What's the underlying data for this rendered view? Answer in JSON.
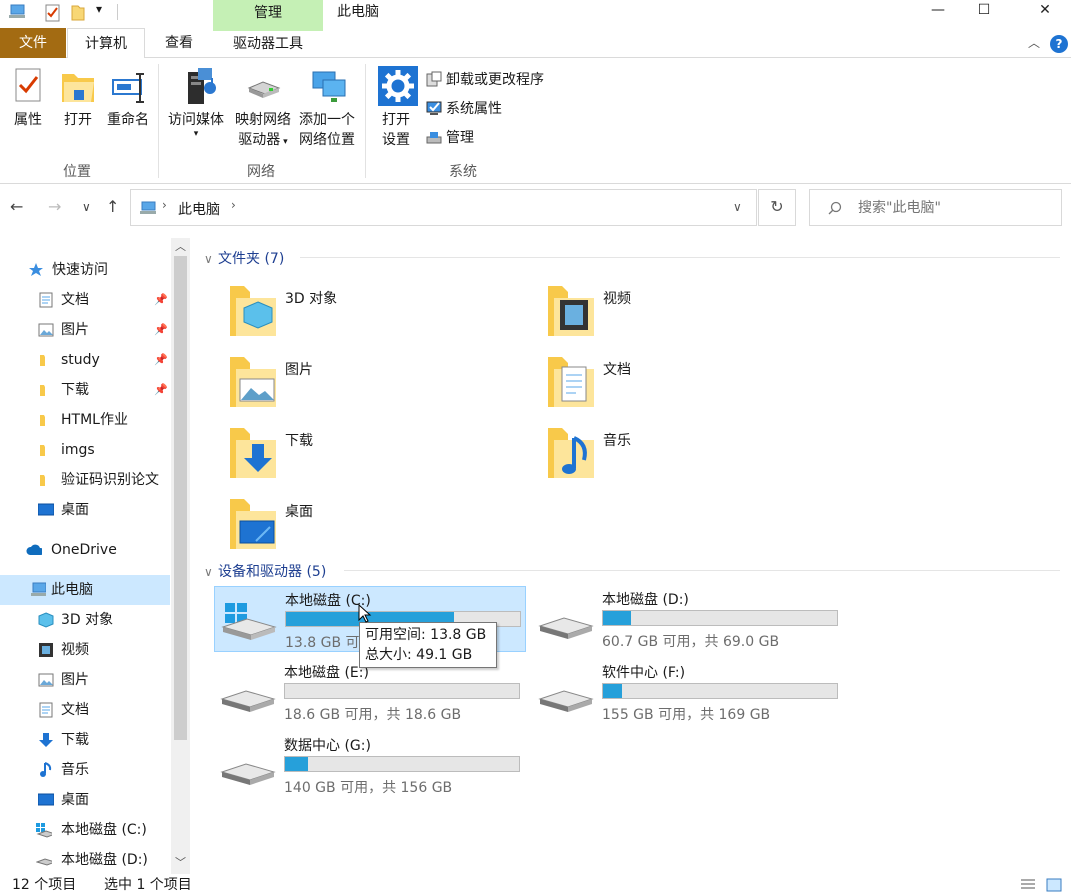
{
  "titlebar": {
    "title": "此电脑",
    "context_group": "管理",
    "qa_dropdown": "▾",
    "minimize": "—",
    "maximize": "☐",
    "close": "✕"
  },
  "tabs": {
    "file": "文件",
    "computer": "计算机",
    "view": "查看",
    "drive_tools": "驱动器工具"
  },
  "ribbon": {
    "properties": "属性",
    "open": "打开",
    "rename": "重命名",
    "access_media": "访问媒体",
    "map_drive_line1": "映射网络",
    "map_drive_line2": "驱动器",
    "add_location_line1": "添加一个",
    "add_location_line2": "网络位置",
    "open_settings_line1": "打开",
    "open_settings_line2": "设置",
    "uninstall": "卸载或更改程序",
    "system_props": "系统属性",
    "manage": "管理",
    "group_location": "位置",
    "group_network": "网络",
    "group_system": "系统",
    "help": "?"
  },
  "address": {
    "path": "此电脑",
    "search_placeholder": "搜索\"此电脑\""
  },
  "navpane": {
    "quick_access": "快速访问",
    "items": [
      {
        "label": "文档"
      },
      {
        "label": "图片"
      },
      {
        "label": "study"
      },
      {
        "label": "下载"
      },
      {
        "label": "HTML作业"
      },
      {
        "label": "imgs"
      },
      {
        "label": "验证码识别论文"
      },
      {
        "label": "桌面"
      }
    ],
    "onedrive": "OneDrive",
    "this_pc": "此电脑",
    "pc_items": [
      {
        "label": "3D 对象"
      },
      {
        "label": "视频"
      },
      {
        "label": "图片"
      },
      {
        "label": "文档"
      },
      {
        "label": "下载"
      },
      {
        "label": "音乐"
      },
      {
        "label": "桌面"
      },
      {
        "label": "本地磁盘 (C:)"
      },
      {
        "label": "本地磁盘 (D:)"
      }
    ]
  },
  "content": {
    "folders_header": "文件夹 (7)",
    "folders": [
      {
        "name": "3D 对象"
      },
      {
        "name": "视频"
      },
      {
        "name": "图片"
      },
      {
        "name": "文档"
      },
      {
        "name": "下载"
      },
      {
        "name": "音乐"
      },
      {
        "name": "桌面"
      }
    ],
    "drives_header": "设备和驱动器 (5)",
    "drives": [
      {
        "name": "本地磁盘 (C:)",
        "info": "13.8 GB 可用，共 49.1 GB",
        "used_fraction": 0.72
      },
      {
        "name": "本地磁盘 (D:)",
        "info": "60.7 GB 可用，共 69.0 GB",
        "used_fraction": 0.12
      },
      {
        "name": "本地磁盘 (E:)",
        "info": "18.6 GB 可用，共 18.6 GB",
        "used_fraction": 0.0
      },
      {
        "name": "软件中心 (F:)",
        "info": "155 GB 可用，共 169 GB",
        "used_fraction": 0.08
      },
      {
        "name": "数据中心 (G:)",
        "info": "140 GB 可用，共 156 GB",
        "used_fraction": 0.1
      }
    ],
    "tooltip_line1": "可用空间: 13.8 GB",
    "tooltip_line2": "总大小: 49.1 GB"
  },
  "status": {
    "count": "12 个项目",
    "selected": "选中 1 个项目"
  },
  "colors": {
    "file_tab": "#a36b12",
    "context_tab": "#c5f0b5",
    "selection": "#cce8ff",
    "drive_bar": "#26a0da",
    "section_header": "#1e3f91"
  }
}
